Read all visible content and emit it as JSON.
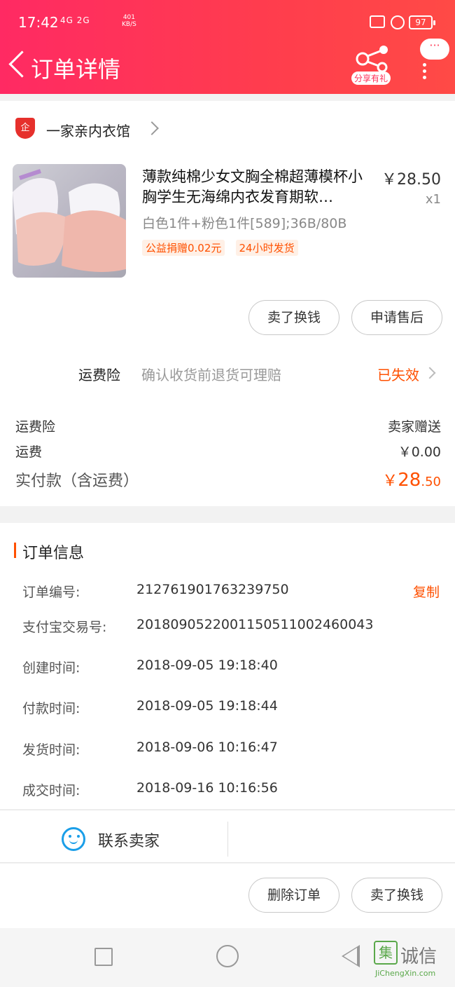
{
  "status_bar": {
    "time": "17:42",
    "signal": "4G 2G",
    "speed": "401",
    "speed_unit": "KB/S",
    "battery": "97"
  },
  "header": {
    "title": "订单详情",
    "share_label": "分享有礼",
    "chat_dots": "···",
    "accent_color": "#ff2a63"
  },
  "shop": {
    "icon_text": "企",
    "name": "一家亲内衣馆"
  },
  "product": {
    "title": "薄款纯棉少女文胸全棉超薄模杯小胸学生无海绵内衣发育期软…",
    "price": "￥28.50",
    "qty": "x1",
    "spec": "白色1件+粉色1件[589];36B/80B",
    "tags": [
      "公益捐赠0.02元",
      "24小时发货"
    ]
  },
  "actions_top": {
    "sell": "卖了换钱",
    "after_sale": "申请售后"
  },
  "insurance": {
    "label": "运费险",
    "desc": "确认收货前退货可理赔",
    "status": "已失效"
  },
  "fees": {
    "ins_label": "运费险",
    "ins_value": "卖家赠送",
    "ship_label": "运费",
    "ship_value": "￥0.00",
    "total_label": "实付款（含运费）",
    "total_currency": "￥",
    "total_int": "28",
    "total_dec": ".50"
  },
  "order_info": {
    "title": "订单信息",
    "copy": "复制",
    "rows": [
      {
        "k": "订单编号:",
        "v": "212761901763239750"
      },
      {
        "k": "支付宝交易号:",
        "v": "2018090522001150511002460043"
      },
      {
        "k": "创建时间:",
        "v": "2018-09-05 19:18:40"
      },
      {
        "k": "付款时间:",
        "v": "2018-09-05 19:18:44"
      },
      {
        "k": "发货时间:",
        "v": "2018-09-06 10:16:47"
      },
      {
        "k": "成交时间:",
        "v": "2018-09-16 10:16:56"
      }
    ]
  },
  "contact": {
    "label": "联系卖家"
  },
  "actions_bottom": {
    "delete": "删除订单",
    "sell": "卖了换钱"
  },
  "watermark": {
    "box": "集",
    "text": "诚信",
    "sub": "JiChengXin.com"
  }
}
